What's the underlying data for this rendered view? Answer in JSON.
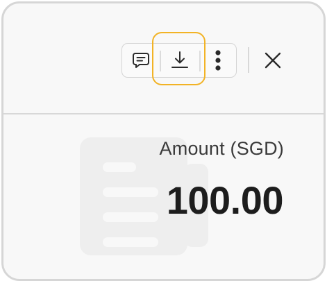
{
  "toolbar": {
    "buttons": [
      {
        "icon": "comment-icon"
      },
      {
        "icon": "download-icon",
        "focused": true
      },
      {
        "icon": "more-vertical-icon"
      }
    ],
    "close_icon": "close-icon"
  },
  "amount": {
    "label": "Amount (SGD)",
    "value": "100.00"
  },
  "background_icon": "document-icon",
  "colors": {
    "focus_ring": "#f2b325",
    "card_background": "#f8f8f8",
    "card_border": "#d6d6d6",
    "text_primary": "#1d1d1d",
    "text_secondary": "#3a3a3a",
    "watermark": "#eeeeee"
  }
}
